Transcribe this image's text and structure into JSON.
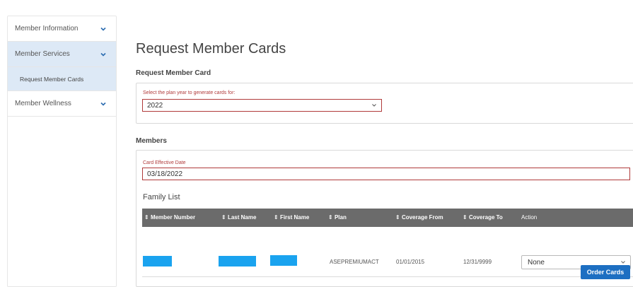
{
  "sidebar": {
    "items": [
      {
        "label": "Member Information",
        "icon": "chevron-down-icon"
      },
      {
        "label": "Member Services",
        "icon": "chevron-down-icon"
      },
      {
        "label": "Request Member Cards"
      },
      {
        "label": "Member Wellness",
        "icon": "chevron-down-icon"
      }
    ]
  },
  "main": {
    "title": "Request Member Cards",
    "request_section": {
      "title": "Request Member Card",
      "plan_year_label": "Select the plan year to generate cards for:",
      "plan_year_value": "2022"
    },
    "members_section": {
      "title": "Members",
      "card_date_label": "Card Effective Date",
      "card_date_value": "03/18/2022",
      "family_title": "Family List",
      "columns": [
        "Member Number",
        "Last Name",
        "First Name",
        "Plan",
        "Coverage From",
        "Coverage To",
        "Action"
      ],
      "sort_glyph": "⇕",
      "rows": [
        {
          "plan": "ASEPREMIUMACT",
          "coverage_from": "01/01/2015",
          "coverage_to": "12/31/9999",
          "action": "None"
        }
      ],
      "order_button": "Order Cards"
    }
  },
  "colors": {
    "accent": "#1d6fc2",
    "error_border": "#b03a3a",
    "active_nav": "#dde9f6",
    "table_header": "#6b6b6b",
    "redaction": "#1aa3ef"
  }
}
